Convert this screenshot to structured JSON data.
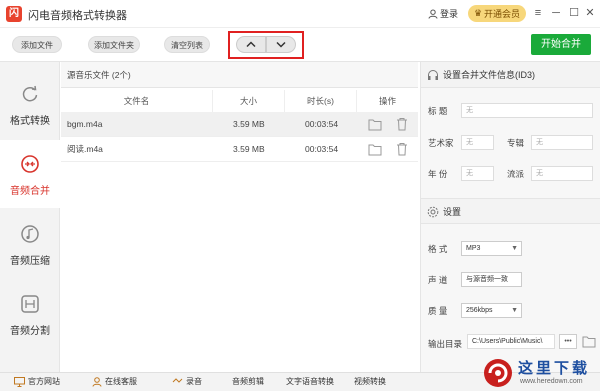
{
  "app": {
    "title": "闪电音频格式转换器",
    "logo": "闪"
  },
  "titlebar": {
    "login": "登录",
    "vip": "开通会员",
    "min": "─",
    "max": "☐",
    "close": "✕"
  },
  "toolbar": {
    "add_file": "添加文件",
    "add_folder": "添加文件夹",
    "clear_list": "清空列表",
    "start_merge": "开始合并"
  },
  "sidebar": {
    "items": [
      {
        "label": "格式转换"
      },
      {
        "label": "音频合并"
      },
      {
        "label": "音频压缩"
      },
      {
        "label": "音频分割"
      }
    ]
  },
  "file_panel": {
    "header": "源音乐文件 (2个)",
    "columns": [
      "文件名",
      "大小",
      "时长(s)",
      "操作"
    ],
    "rows": [
      {
        "name": "bgm.m4a",
        "size": "3.59 MB",
        "duration": "00:03:54"
      },
      {
        "name": "阅读.m4a",
        "size": "3.59 MB",
        "duration": "00:03:54"
      }
    ]
  },
  "merge_info": {
    "header": "设置合并文件信息(ID3)",
    "title_label": "标 题",
    "artist_label": "艺术家",
    "album_label": "专辑",
    "year_label": "年 份",
    "genre_label": "流派",
    "placeholder": "无"
  },
  "settings": {
    "header": "设置",
    "format_label": "格 式",
    "format_value": "MP3",
    "channel_label": "声 道",
    "channel_value": "与源音频一致",
    "quality_label": "质 量",
    "quality_value": "256kbps",
    "output_label": "输出目录",
    "output_value": "C:\\Users\\Public\\Music\\",
    "more": "•••"
  },
  "bottombar": {
    "website": "官方网站",
    "service": "在线客服",
    "record": "录音",
    "edit": "音频剪辑",
    "tts": "文字语音转换",
    "video": "视频转换"
  },
  "watermark": {
    "text": "这里下载",
    "url": "www.heredown.com"
  },
  "colors": {
    "accent": "#d8342c",
    "green": "#1aaa3a",
    "vip": "#f7d77b",
    "highlight": "#e02020"
  }
}
